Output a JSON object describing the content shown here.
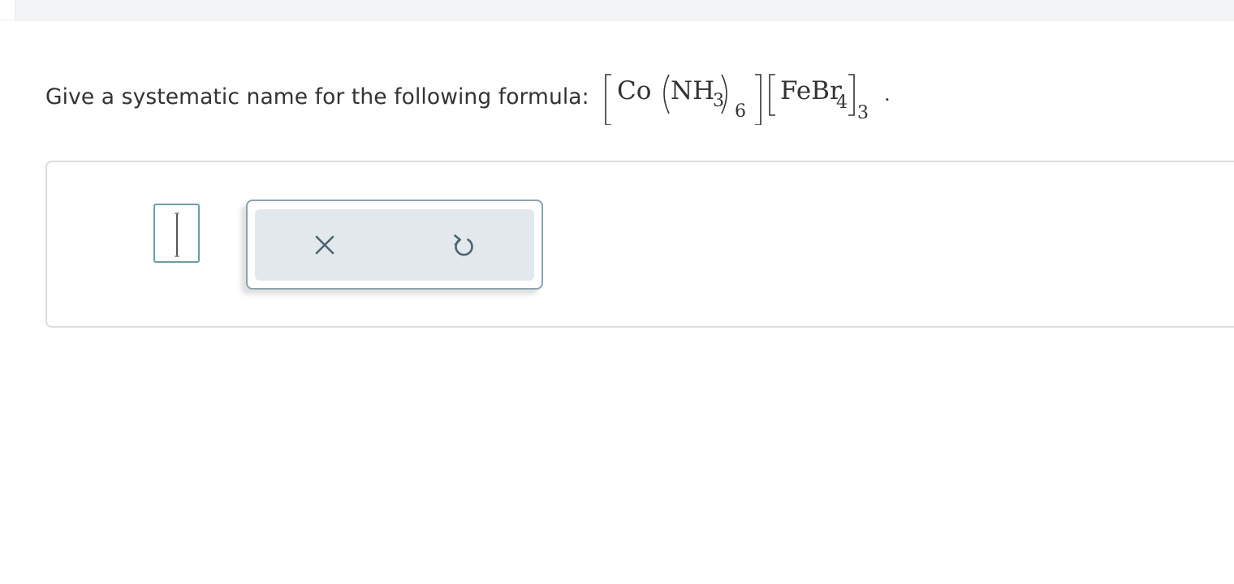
{
  "question": {
    "prompt": "Give a systematic name for the following formula:",
    "formula": {
      "cation_metal": "Co",
      "ligand": "NH",
      "ligand_subscript": "3",
      "ligand_count": "6",
      "anion": "FeBr",
      "anion_subscript": "4",
      "anion_count": "3",
      "terminator": "."
    }
  },
  "answer": {
    "value": ""
  },
  "toolbar": {
    "icons": [
      "clear-icon",
      "undo-icon"
    ]
  },
  "colors": {
    "text": "#333333",
    "input_border": "#6d9ea6",
    "toolbar_bg": "#e3e8ec",
    "icon": "#4a6470"
  }
}
